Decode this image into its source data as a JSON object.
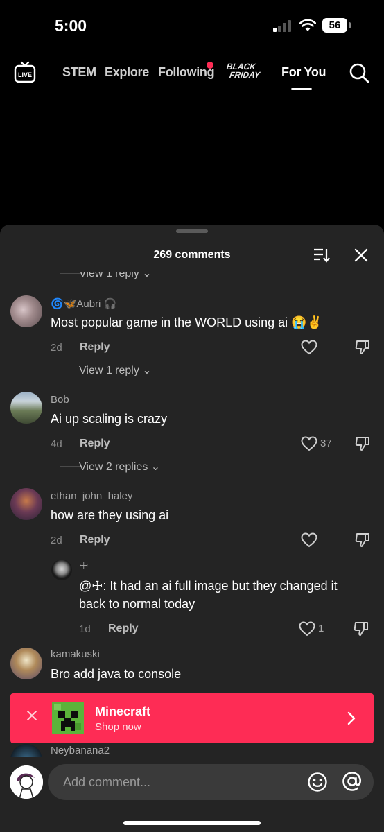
{
  "status_bar": {
    "time": "5:00",
    "battery": "56"
  },
  "top_nav": {
    "live_label": "LIVE",
    "items": [
      "STEM",
      "Explore",
      "Following",
      "For You"
    ],
    "black_friday": [
      "BLACK",
      "FRIDAY"
    ]
  },
  "comments_sheet": {
    "title": "269 comments",
    "partial_view_replies": "View 1 reply",
    "comments": [
      {
        "username": "🌀🦋Aubri 🎧",
        "text": "Most popular game in the WORLD using ai 😭✌️",
        "age": "2d",
        "reply_label": "Reply",
        "likes": "",
        "view_replies": "View 1 reply"
      },
      {
        "username": "Bob",
        "text": "Ai up scaling is crazy",
        "age": "4d",
        "reply_label": "Reply",
        "likes": "37",
        "view_replies": "View 2 replies"
      },
      {
        "username": "ethan_john_haley",
        "text": "how are they using ai",
        "age": "2d",
        "reply_label": "Reply",
        "likes": ""
      },
      {
        "username": "kamakuski",
        "text": "Bro add java to console"
      },
      {
        "username": "Neybanana2"
      }
    ],
    "nested_reply": {
      "username": "☩",
      "text_line1": "@☩: It had an ai full image but they changed it",
      "text_line2": "back to normal today",
      "age": "1d",
      "reply_label": "Reply",
      "likes": "1"
    }
  },
  "shop_banner": {
    "title": "Minecraft",
    "subtitle": "Shop now"
  },
  "composer": {
    "placeholder": "Add comment..."
  },
  "colors": {
    "accent": "#fe2c55",
    "sheet_bg": "#242424",
    "minecraft_green": "#5bb33a"
  }
}
